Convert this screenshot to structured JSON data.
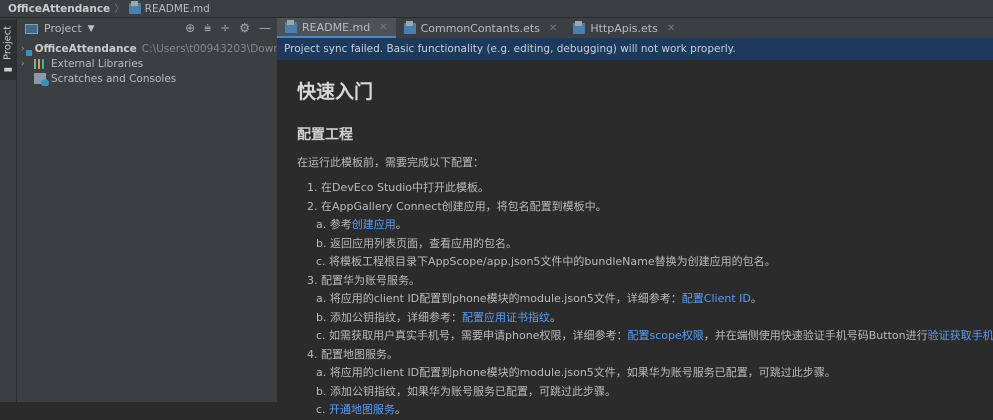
{
  "titlebar": {
    "project": "OfficeAttendance",
    "file": "README.md"
  },
  "strip": {
    "label": "Project"
  },
  "panel": {
    "title": "Project",
    "tree": [
      {
        "label": "OfficeAttendance",
        "path": "C:\\Users\\t00943203\\Downloads\\"
      },
      {
        "label": "External Libraries"
      },
      {
        "label": "Scratches and Consoles"
      }
    ]
  },
  "tabs": [
    {
      "label": "README.md"
    },
    {
      "label": "CommonContants.ets"
    },
    {
      "label": "HttpApis.ets"
    }
  ],
  "banner": "Project sync failed. Basic functionality (e.g. editing, debugging) will not work properly.",
  "doc": {
    "h1": "快速入门",
    "h2": "配置工程",
    "intro": "在运行此模板前，需要完成以下配置：",
    "lines": [
      {
        "level": 1,
        "segs": [
          {
            "t": "1. 在DevEco Studio中打开此模板。"
          }
        ]
      },
      {
        "level": 1,
        "segs": [
          {
            "t": "2. 在AppGallery Connect创建应用，将包名配置到模板中。"
          }
        ]
      },
      {
        "level": 2,
        "segs": [
          {
            "t": "a. 参考"
          },
          {
            "t": "创建应用",
            "link": true
          },
          {
            "t": "。"
          }
        ]
      },
      {
        "level": 2,
        "segs": [
          {
            "t": "b. 返回应用列表页面，查看应用的包名。"
          }
        ]
      },
      {
        "level": 2,
        "segs": [
          {
            "t": "c. 将模板工程根目录下AppScope/app.json5文件中的bundleName替换为创建应用的包名。"
          }
        ]
      },
      {
        "level": 1,
        "segs": [
          {
            "t": "3. 配置华为账号服务。"
          }
        ]
      },
      {
        "level": 2,
        "segs": [
          {
            "t": "a. 将应用的client ID配置到phone模块的module.json5文件，详细参考："
          },
          {
            "t": "配置Client ID",
            "link": true
          },
          {
            "t": "。"
          }
        ]
      },
      {
        "level": 2,
        "segs": [
          {
            "t": "b. 添加公钥指纹，详细参考："
          },
          {
            "t": "配置应用证书指纹",
            "link": true
          },
          {
            "t": "。"
          }
        ]
      },
      {
        "level": 2,
        "segs": [
          {
            "t": "c. 如需获取用户真实手机号，需要申请phone权限，详细参考："
          },
          {
            "t": "配置scope权限",
            "link": true
          },
          {
            "t": "，并在端侧使用快速验证手机号码Button进行"
          },
          {
            "t": "验证获取手机号码",
            "link": true
          },
          {
            "t": "。"
          }
        ]
      },
      {
        "level": 1,
        "segs": [
          {
            "t": "4. 配置地图服务。"
          }
        ]
      },
      {
        "level": 2,
        "segs": [
          {
            "t": "a. 将应用的client ID配置到phone模块的module.json5文件，如果华为账号服务已配置，可跳过此步骤。"
          }
        ]
      },
      {
        "level": 2,
        "segs": [
          {
            "t": "b. 添加公钥指纹，如果华为账号服务已配置，可跳过此步骤。"
          }
        ]
      },
      {
        "level": 2,
        "segs": [
          {
            "t": "c. "
          },
          {
            "t": "开通地图服务",
            "link": true
          },
          {
            "t": "。"
          }
        ]
      }
    ]
  },
  "colors": {
    "link": "#589df6",
    "banner": "#1d3a5c",
    "background": "#2b2b2b",
    "panel": "#3c3f41"
  }
}
